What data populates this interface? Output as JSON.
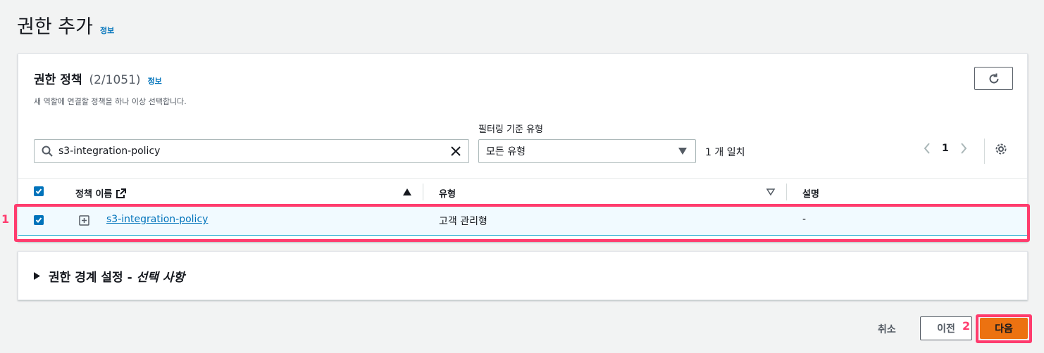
{
  "page": {
    "title": "권한 추가",
    "info": "정보"
  },
  "policies": {
    "title": "권한 정책",
    "count": "(2/1051)",
    "info": "정보",
    "description": "새 역할에 연결할 정책을 하나 이상 선택합니다.",
    "filter_label": "필터링 기준 유형",
    "search_value": "s3-integration-policy",
    "type_selected": "모든 유형",
    "match_count": "1 개 일치",
    "page_number": "1",
    "columns": [
      "정책 이름",
      "유형",
      "설명"
    ],
    "rows": [
      {
        "name": "s3-integration-policy",
        "type": "고객 관리형",
        "description": "-",
        "selected": true
      }
    ]
  },
  "boundary": {
    "title": "권한 경계 설정 -",
    "optional": "선택 사항"
  },
  "footer": {
    "cancel": "취소",
    "previous": "이전",
    "next": "다음"
  },
  "annotations": {
    "step1": "1",
    "step2": "2"
  },
  "colors": {
    "accent": "#0073bb",
    "primary_button": "#ec7211",
    "highlight": "#ff3c6e"
  }
}
